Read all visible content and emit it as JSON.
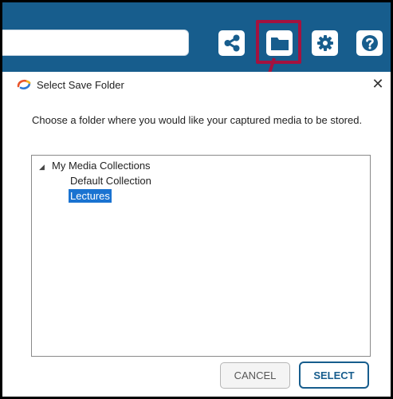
{
  "toolbar": {
    "search_value": "",
    "buttons": [
      {
        "name": "share-icon"
      },
      {
        "name": "folder-icon"
      },
      {
        "name": "settings-icon"
      },
      {
        "name": "help-icon"
      }
    ]
  },
  "dialog": {
    "title": "Select Save Folder",
    "close_glyph": "✕",
    "description": "Choose a folder where you would like your captured media to be stored.",
    "tree": {
      "root_label": "My Media Collections",
      "root_caret": "◢",
      "children": [
        {
          "label": "Default Collection",
          "selected": false
        },
        {
          "label": "Lectures",
          "selected": true
        }
      ]
    },
    "cancel_label": "CANCEL",
    "select_label": "SELECT"
  },
  "colors": {
    "toolbar_bg": "#175d8d",
    "highlight": "#a4123f",
    "selection": "#1a73d1"
  }
}
